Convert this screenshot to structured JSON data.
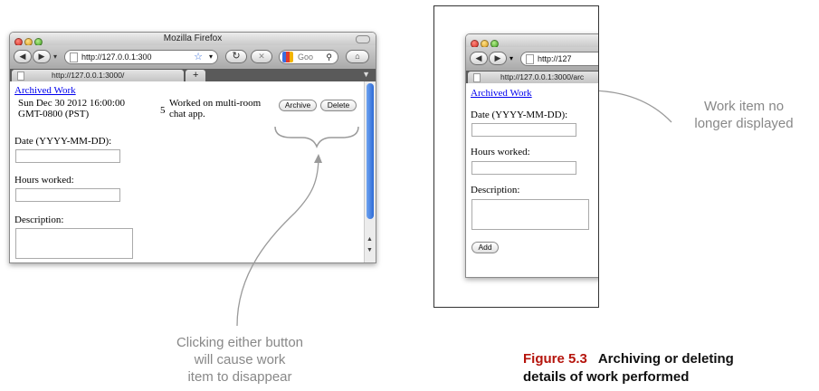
{
  "left_browser": {
    "window_title": "Mozilla Firefox",
    "url": "http://127.0.0.1:300",
    "search_text": "Goo",
    "tab_title": "http://127.0.0.1:3000/",
    "new_tab": "+",
    "page": {
      "archived_link": "Archived Work",
      "work_item": {
        "date_line1": "Sun Dec 30 2012 16:00:00",
        "date_line2": "GMT-0800 (PST)",
        "hours": "5",
        "desc_line1": "Worked on multi-room",
        "desc_line2": "chat app.",
        "archive_label": "Archive",
        "delete_label": "Delete"
      },
      "date_label": "Date (YYYY-MM-DD):",
      "hours_label": "Hours worked:",
      "desc_label": "Description:"
    }
  },
  "right_browser": {
    "url": "http://127",
    "tab_title": "http://127.0.0.1:3000/arc",
    "page": {
      "archived_link": "Archived Work",
      "date_label": "Date (YYYY-MM-DD):",
      "hours_label": "Hours worked:",
      "desc_label": "Description:",
      "add_label": "Add"
    }
  },
  "annotations": {
    "left_line1": "Clicking either button",
    "left_line2": "will cause work",
    "left_line3": "item to disappear",
    "right_line1": "Work item no",
    "right_line2": "longer displayed"
  },
  "figure": {
    "number": "Figure 5.3",
    "title_line1": "Archiving or deleting",
    "title_line2": "details of work performed"
  }
}
